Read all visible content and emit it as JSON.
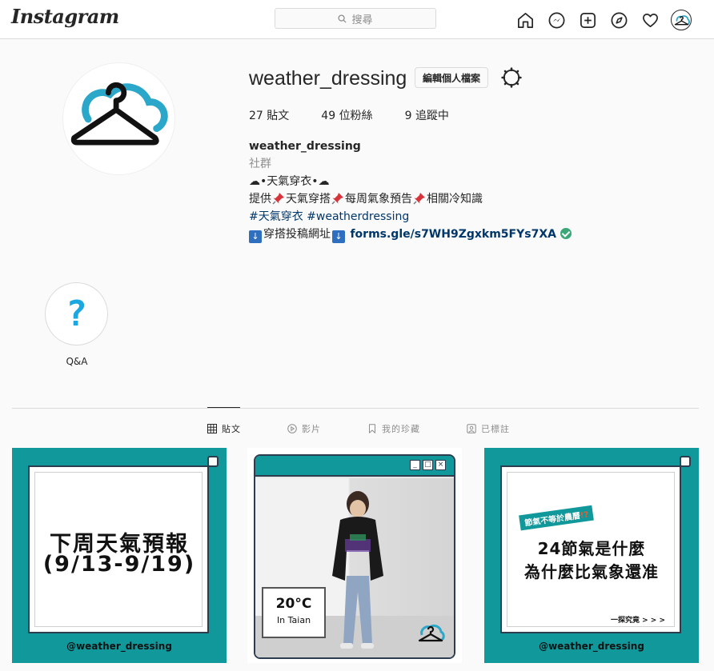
{
  "nav": {
    "logo": "Instagram",
    "search_placeholder": "搜尋"
  },
  "profile": {
    "username": "weather_dressing",
    "edit_label": "編輯個人檔案",
    "stats": {
      "posts_count": "27",
      "posts_label": "貼文",
      "followers_count": "49",
      "followers_label": "位粉絲",
      "following_count": "9",
      "following_label": "追蹤中"
    },
    "bio": {
      "name": "weather_dressing",
      "category": "社群",
      "tagline": "☁•天氣穿衣•☁",
      "line_provide": "提供",
      "item1": "天氣穿搭",
      "item2": "每周氣象預告",
      "item3": "相關冷知識",
      "hashtags": "#天氣穿衣 #weatherdressing",
      "arrow": "↓",
      "submit_label": "穿搭投稿網址",
      "link": "forms.gle/s7WH9Zgxkm5FYs7XA"
    }
  },
  "highlights": [
    {
      "symbol": "?",
      "label": "Q&A"
    }
  ],
  "tabs": [
    {
      "label": "貼文",
      "active": true
    },
    {
      "label": "影片",
      "active": false
    },
    {
      "label": "我的珍藏",
      "active": false
    },
    {
      "label": "已標註",
      "active": false
    }
  ],
  "posts": [
    {
      "line1": "下周天氣預報",
      "line2": "(9/13-9/19)",
      "handle": "@weather_dressing"
    },
    {
      "win_min": "_",
      "win_max": "□",
      "win_close": "×",
      "temp": "20°C",
      "location": "In Taian"
    },
    {
      "tag_text": "節氣不等於農曆",
      "tag_accent": "!?",
      "line1": "24節氣是什麼",
      "line2": "為什麼比氣象還准",
      "more": "一探究竟 > > >",
      "handle": "@weather_dressing"
    }
  ],
  "colors": {
    "brand_teal": "#11989a",
    "link_blue": "#00376b",
    "hanger_teal": "#2aa7c9"
  }
}
